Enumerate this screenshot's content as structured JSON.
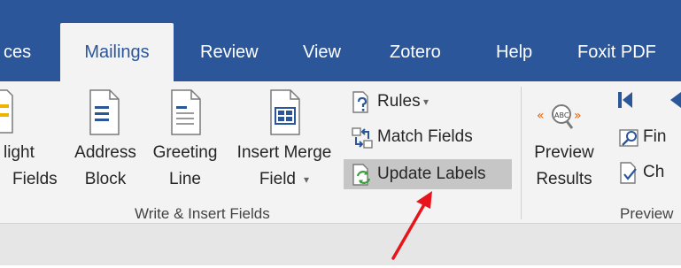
{
  "tabs": [
    {
      "label": "ces",
      "active": false
    },
    {
      "label": "Mailings",
      "active": true
    },
    {
      "label": "Review",
      "active": false
    },
    {
      "label": "View",
      "active": false
    },
    {
      "label": "Zotero",
      "active": false
    },
    {
      "label": "Help",
      "active": false
    },
    {
      "label": "Foxit PDF",
      "active": false
    }
  ],
  "write_insert_group": {
    "highlight_fields": {
      "line1": "light",
      "line2": "Fields"
    },
    "address_block": {
      "line1": "Address",
      "line2": "Block"
    },
    "greeting_line": {
      "line1": "Greeting",
      "line2": "Line"
    },
    "insert_merge_field": {
      "line1": "Insert Merge",
      "line2": "Field",
      "caret": "▾"
    },
    "rules": {
      "label": "Rules",
      "caret": "▾"
    },
    "match_fields": {
      "label": "Match Fields"
    },
    "update_labels": {
      "label": "Update Labels"
    },
    "group_label": "Write & Insert Fields"
  },
  "preview_group": {
    "preview_results": {
      "line1": "Preview",
      "line2": "Results"
    },
    "find": {
      "label": "Fin"
    },
    "check": {
      "label": "Ch"
    },
    "group_label": "Preview"
  },
  "annotation": {
    "type": "arrow",
    "color": "#e8141b"
  },
  "colors": {
    "ribbon_blue": "#2b579a",
    "ribbon_bg": "#f3f3f3",
    "highlight": "#c6c6c6",
    "icon_blue": "#2b579a"
  }
}
